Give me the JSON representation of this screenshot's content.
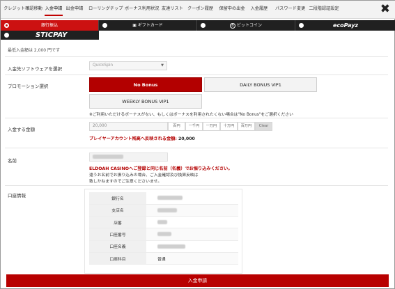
{
  "top_tabs": [
    "クレジット確認移動",
    "入金申請",
    "出金申請",
    "ローリングチップ",
    "ボーナス利用状況",
    "友達リスト",
    "クーポン履歴",
    "保留中の出金",
    "入金履歴",
    "パスワード変更",
    "二段階認証設定"
  ],
  "active_tab": "入金申請",
  "close_icon": "✖",
  "methods": {
    "bank": "銀行振込",
    "giftcard": "ギフトカード",
    "bitcoin": "ビットコイン",
    "ecopayz": "ecoPayz",
    "sticpay": "STICPAY"
  },
  "min_note": "最低入金額は 2,000 円です",
  "software": {
    "label": "入金先ソフトウェアを選択",
    "value": "QuickSpin"
  },
  "promotion": {
    "label": "プロモーション選択",
    "options": [
      "No Bonus",
      "DAILY BONUS VIP1",
      "WEEKLY BONUS VIP1"
    ],
    "selected": "No Bonus",
    "note": "※ご利用いただけるボーナスがない、もしくはボーナスを利用されたくない場合は\"No Bonus\"をご選択ください"
  },
  "amount": {
    "label": "入金する金額",
    "value": "20,000",
    "quick_buttons": [
      "百円",
      "一千円",
      "一万円",
      "十万円",
      "百万円",
      "Clear"
    ],
    "reflect_label": "プレイヤーアカウント残高へ反映される金額:",
    "reflect_value": "20,000"
  },
  "name": {
    "label": "名前",
    "warning": "ELDOAH CASINOへご登録と同じ名前（名義）でお振り込みください。",
    "note_lines": [
      "違うお名前でお振り込みの場合、ご入金確認及び換算反映は",
      "致しかねますのでご注意くださいませ。"
    ]
  },
  "account": {
    "label": "口座情報",
    "rows": [
      {
        "key": "銀行名",
        "value": ""
      },
      {
        "key": "支店名",
        "value": ""
      },
      {
        "key": "店番",
        "value": ""
      },
      {
        "key": "口座番号",
        "value": ""
      },
      {
        "key": "口座名義",
        "value": ""
      },
      {
        "key": "口座科目",
        "value": "普通"
      }
    ]
  },
  "submit_label": "入金申請",
  "colors": {
    "accent": "#b80000",
    "dark_bar": "#202020"
  }
}
